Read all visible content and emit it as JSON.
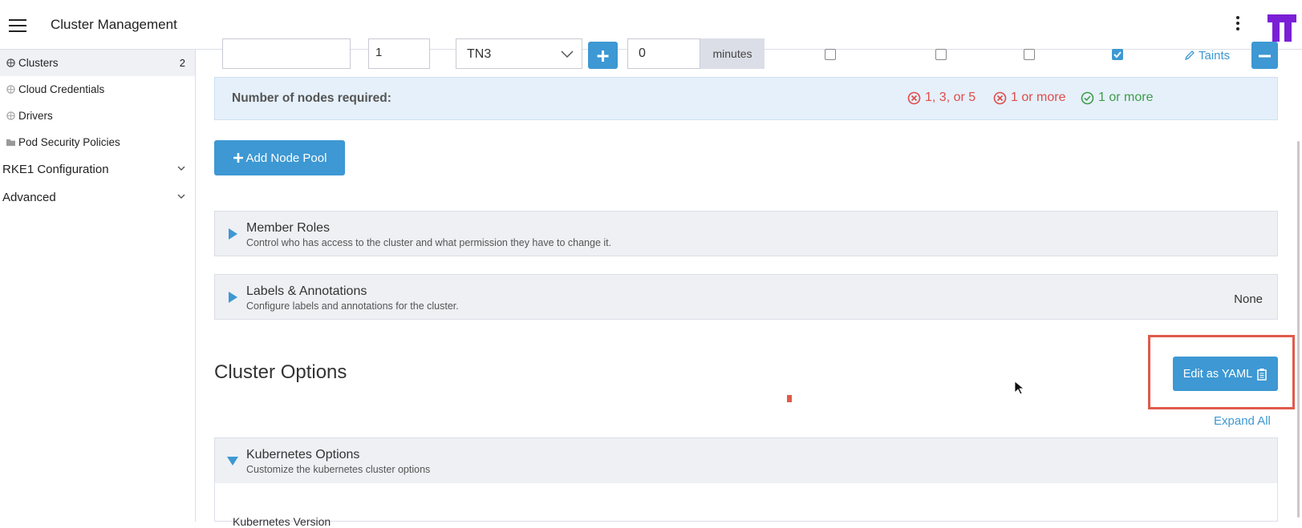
{
  "header": {
    "title": "Cluster Management"
  },
  "sidebar": {
    "items": [
      {
        "label": "Clusters",
        "count": "2"
      },
      {
        "label": "Cloud Credentials"
      },
      {
        "label": "Drivers"
      },
      {
        "label": "Pod Security Policies"
      }
    ],
    "groups": [
      {
        "label": "RKE1 Configuration"
      },
      {
        "label": "Advanced"
      }
    ]
  },
  "pool": {
    "quantity": "1",
    "template": "TN3",
    "delay_value": "0",
    "delay_unit": "minutes",
    "roles_checked": [
      false,
      false,
      false,
      true
    ],
    "taints_label": "Taints"
  },
  "nodes_required": {
    "label": "Number of nodes required:",
    "etcd": "1, 3, or 5",
    "control_plane": "1 or more",
    "worker": "1 or more"
  },
  "add_node_pool_label": "Add Node Pool",
  "member_roles": {
    "title": "Member Roles",
    "subtitle": "Control who has access to the cluster and what permission they have to change it."
  },
  "labels_annotations": {
    "title": "Labels & Annotations",
    "subtitle": "Configure labels and annotations for the cluster.",
    "value": "None"
  },
  "cluster_options": {
    "title": "Cluster Options",
    "edit_yaml_label": "Edit as YAML",
    "expand_all_label": "Expand All"
  },
  "kubernetes_options": {
    "title": "Kubernetes Options",
    "subtitle": "Customize the kubernetes cluster options",
    "version_label": "Kubernetes Version"
  },
  "colors": {
    "primary": "#3d98d3",
    "error": "#e04b4b",
    "success": "#3f9c49",
    "highlight": "#e05a4a",
    "logo": "#7b1fd6"
  }
}
